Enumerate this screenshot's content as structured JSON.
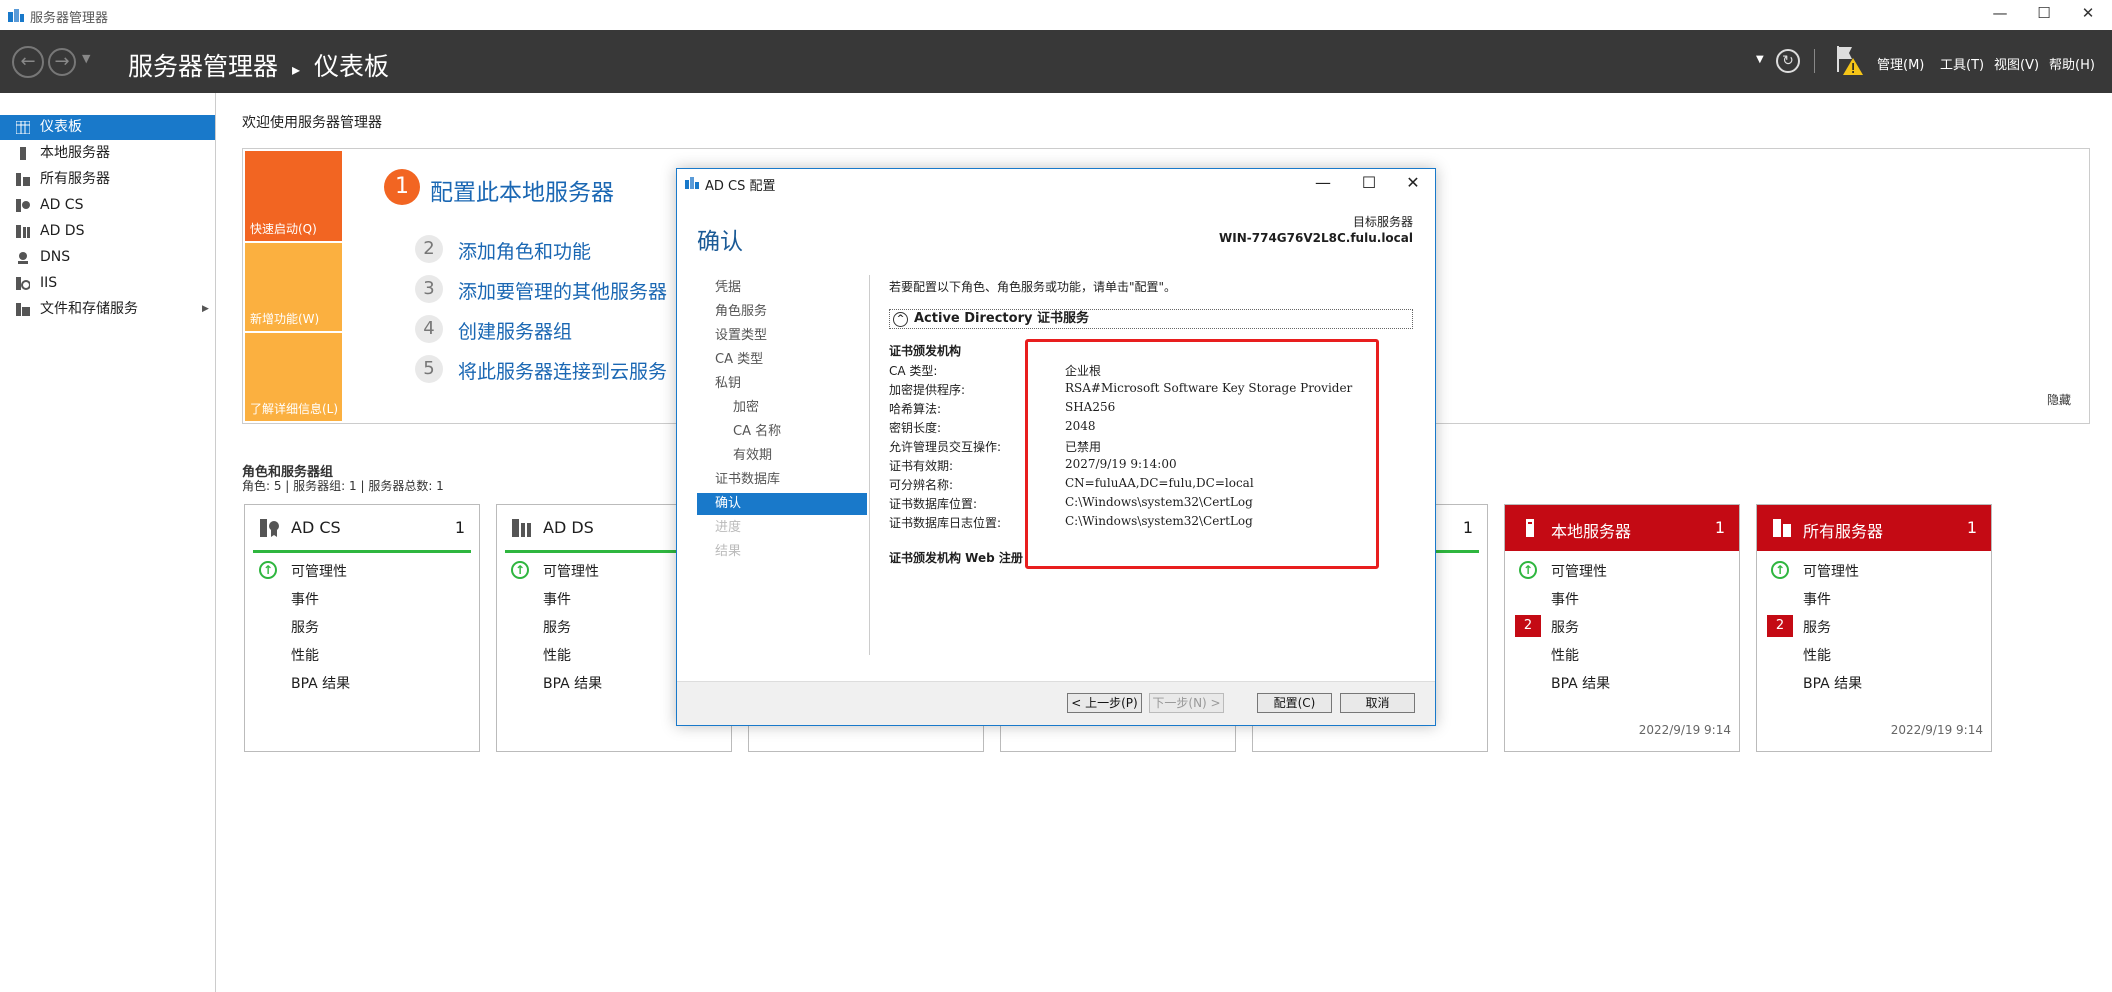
{
  "window": {
    "title": "服务器管理器",
    "minimize": "—",
    "maximize": "☐",
    "close": "✕"
  },
  "header": {
    "breadcrumb_app": "服务器管理器",
    "breadcrumb_sep": "▸",
    "breadcrumb_page": "仪表板",
    "menus": [
      "管理(M)",
      "工具(T)",
      "视图(V)",
      "帮助(H)"
    ]
  },
  "sidebar": {
    "items": [
      {
        "label": "仪表板"
      },
      {
        "label": "本地服务器"
      },
      {
        "label": "所有服务器"
      },
      {
        "label": "AD CS"
      },
      {
        "label": "AD DS"
      },
      {
        "label": "DNS"
      },
      {
        "label": "IIS"
      },
      {
        "label": "文件和存储服务"
      }
    ],
    "expand_arrow": "▶"
  },
  "welcome": {
    "title": "欢迎使用服务器管理器",
    "tiles": [
      "快速启动(Q)",
      "新增功能(W)",
      "了解详细信息(L)"
    ],
    "main_step_num": "1",
    "main_step": "配置此本地服务器",
    "steps": [
      {
        "num": "2",
        "label": "添加角色和功能"
      },
      {
        "num": "3",
        "label": "添加要管理的其他服务器"
      },
      {
        "num": "4",
        "label": "创建服务器组"
      },
      {
        "num": "5",
        "label": "将此服务器连接到云服务"
      }
    ],
    "hide": "隐藏"
  },
  "roles": {
    "title": "角色和服务器组",
    "subtitle": "角色: 5 | 服务器组: 1 | 服务器总数: 1",
    "cards": [
      {
        "name": "AD CS",
        "count": "1",
        "rows": [
          "可管理性",
          "事件",
          "服务",
          "性能",
          "BPA 结果"
        ]
      },
      {
        "name": "AD DS",
        "count": "1",
        "rows": [
          "可管理性",
          "事件",
          "服务",
          "性能",
          "BPA 结果"
        ]
      },
      {
        "name": "本地服务器",
        "count": "1",
        "badge": "2",
        "rows": [
          "可管理性",
          "事件",
          "服务",
          "性能",
          "BPA 结果"
        ],
        "date": "2022/9/19 9:14"
      },
      {
        "name": "所有服务器",
        "count": "1",
        "badge": "2",
        "rows": [
          "可管理性",
          "事件",
          "服务",
          "性能",
          "BPA 结果"
        ],
        "date": "2022/9/19 9:14"
      }
    ],
    "hidden_card_count": "1"
  },
  "dialog": {
    "title": "AD CS 配置",
    "heading": "确认",
    "target_label": "目标服务器",
    "target_value": "WIN-774G76V2L8C.fulu.local",
    "nav": [
      "凭据",
      "角色服务",
      "设置类型",
      "CA 类型",
      "私钥",
      "加密",
      "CA 名称",
      "有效期",
      "证书数据库",
      "确认",
      "进度",
      "结果"
    ],
    "intro": "若要配置以下角色、角色服务或功能，请单击\"配置\"。",
    "section": "Active Directory 证书服务",
    "collapse_glyph": "^",
    "group1": "证书颁发机构",
    "fields": [
      {
        "k": "CA 类型:",
        "v": "企业根"
      },
      {
        "k": "加密提供程序:",
        "v": "RSA#Microsoft Software Key Storage Provider"
      },
      {
        "k": "哈希算法:",
        "v": "SHA256"
      },
      {
        "k": "密钥长度:",
        "v": "2048"
      },
      {
        "k": "允许管理员交互操作:",
        "v": "已禁用"
      },
      {
        "k": "证书有效期:",
        "v": "2027/9/19 9:14:00"
      },
      {
        "k": "可分辨名称:",
        "v": "CN=fuluAA,DC=fulu,DC=local"
      },
      {
        "k": "证书数据库位置:",
        "v": "C:\\Windows\\system32\\CertLog"
      },
      {
        "k": "证书数据库日志位置:",
        "v": "C:\\Windows\\system32\\CertLog"
      }
    ],
    "group2": "证书颁发机构 Web 注册",
    "buttons": {
      "prev": "< 上一步(P)",
      "next": "下一步(N) >",
      "configure": "配置(C)",
      "cancel": "取消"
    }
  },
  "colors": {
    "header": "#383838",
    "accent": "#1979ca",
    "tile1": "#f26522",
    "tile2": "#fbb040",
    "alert": "#c40a14",
    "ok": "#2fb63f",
    "highlight_box": "#e81e1e"
  }
}
